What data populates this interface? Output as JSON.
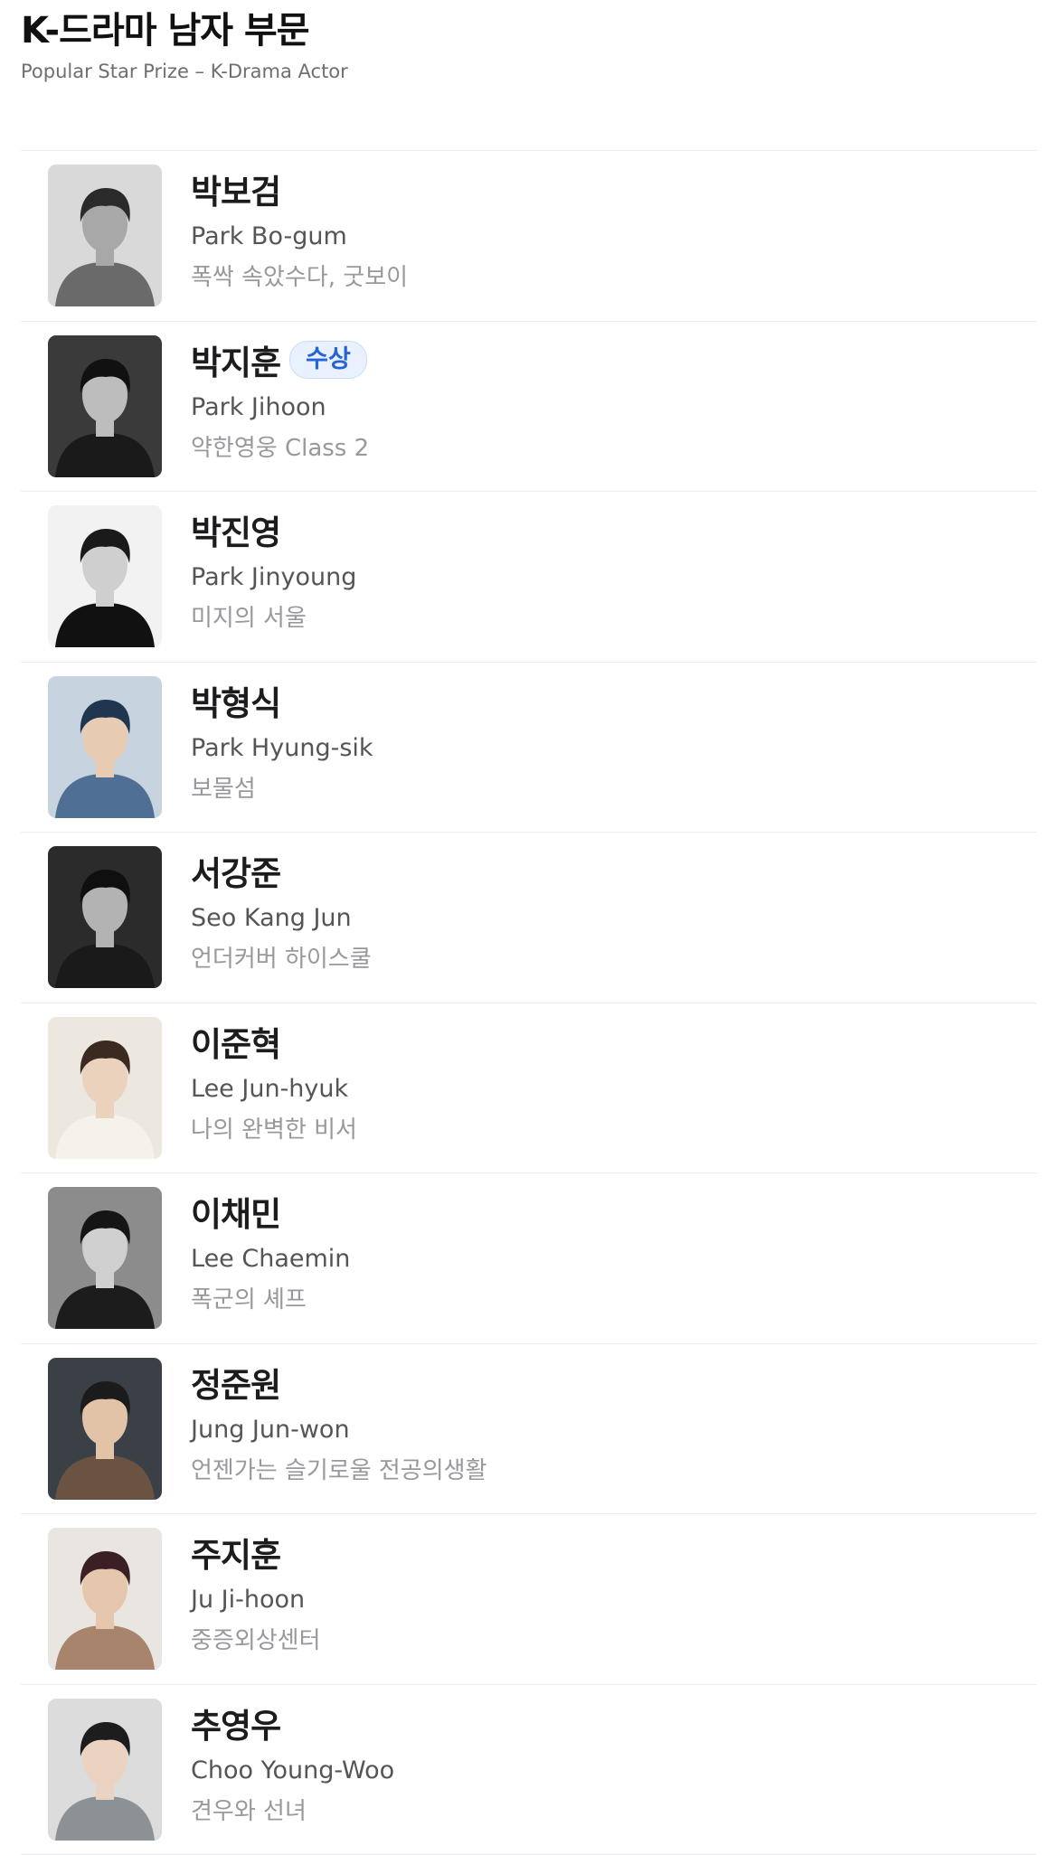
{
  "header": {
    "title": "K-드라마 남자 부문",
    "subtitle": "Popular Star Prize – K-Drama Actor"
  },
  "actors": [
    {
      "name_ko": "박보검",
      "name_en": "Park Bo-gum",
      "dramas": "폭싹 속았수다, 굿보이",
      "badge": null
    },
    {
      "name_ko": "박지훈",
      "name_en": "Park Jihoon",
      "dramas": "약한영웅 Class 2",
      "badge": "수상"
    },
    {
      "name_ko": "박진영",
      "name_en": "Park Jinyoung",
      "dramas": "미지의 서울",
      "badge": null
    },
    {
      "name_ko": "박형식",
      "name_en": "Park Hyung-sik",
      "dramas": "보물섬",
      "badge": null
    },
    {
      "name_ko": "서강준",
      "name_en": "Seo Kang Jun",
      "dramas": "언더커버 하이스쿨",
      "badge": null
    },
    {
      "name_ko": "이준혁",
      "name_en": "Lee Jun-hyuk",
      "dramas": "나의 완벽한 비서",
      "badge": null
    },
    {
      "name_ko": "이채민",
      "name_en": "Lee Chaemin",
      "dramas": "폭군의 셰프",
      "badge": null
    },
    {
      "name_ko": "정준원",
      "name_en": "Jung Jun-won",
      "dramas": "언젠가는 슬기로울 전공의생활",
      "badge": null
    },
    {
      "name_ko": "주지훈",
      "name_en": "Ju Ji-hoon",
      "dramas": "중증외상센터",
      "badge": null
    },
    {
      "name_ko": "추영우",
      "name_en": "Choo Young-Woo",
      "dramas": "견우와 선녀",
      "badge": null
    }
  ],
  "colors": {
    "badge_text": "#2563d6",
    "badge_bg": "#e8f1fd",
    "divider": "#ececee"
  }
}
